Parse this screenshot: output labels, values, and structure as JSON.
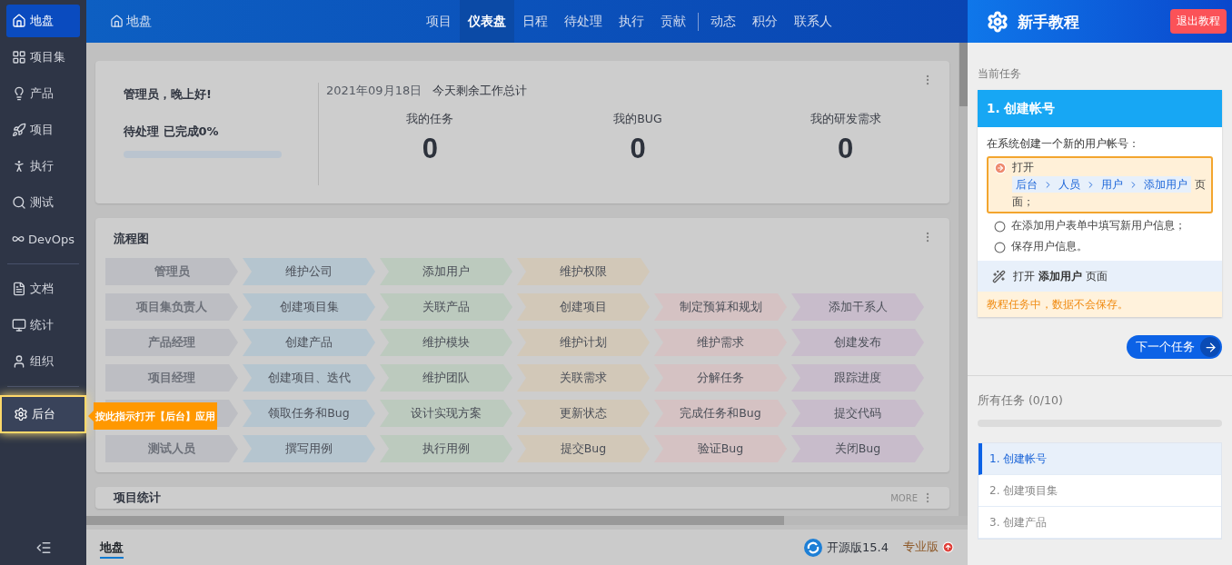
{
  "sidebar": {
    "groups": [
      [
        {
          "label": "地盘",
          "selected": true,
          "highlighted": false
        },
        {
          "label": "项目集",
          "selected": false,
          "highlighted": false
        },
        {
          "label": "产品",
          "selected": false,
          "highlighted": false
        },
        {
          "label": "项目",
          "selected": false,
          "highlighted": false
        },
        {
          "label": "执行",
          "selected": false,
          "highlighted": false
        },
        {
          "label": "测试",
          "selected": false,
          "highlighted": false
        },
        {
          "label": "DevOps",
          "selected": false,
          "highlighted": false
        }
      ],
      [
        {
          "label": "文档",
          "selected": false,
          "highlighted": false
        },
        {
          "label": "统计",
          "selected": false,
          "highlighted": false
        },
        {
          "label": "组织",
          "selected": false,
          "highlighted": false
        }
      ],
      [
        {
          "label": "后台",
          "selected": false,
          "highlighted": true
        }
      ]
    ],
    "tooltip": "按此指示打开【后台】应用"
  },
  "header": {
    "breadcrumb": "地盘",
    "nav_groups": [
      [
        {
          "label": "项目",
          "selected": false
        },
        {
          "label": "仪表盘",
          "selected": true
        },
        {
          "label": "日程",
          "selected": false
        },
        {
          "label": "待处理",
          "selected": false
        },
        {
          "label": "执行",
          "selected": false
        },
        {
          "label": "贡献",
          "selected": false
        }
      ],
      [
        {
          "label": "动态",
          "selected": false
        },
        {
          "label": "积分",
          "selected": false
        },
        {
          "label": "联系人",
          "selected": false
        }
      ]
    ]
  },
  "welcome": {
    "greeting": "管理员，晚上好!",
    "progress_label": "待处理 已完成0%",
    "level": 0,
    "date": "2021年09月18日",
    "summary_title": "今天剩余工作总计",
    "stats": [
      {
        "label": "我的任务",
        "value": "0"
      },
      {
        "label": "我的BUG",
        "value": "0"
      },
      {
        "label": "我的研发需求",
        "value": "0"
      }
    ]
  },
  "flowchart": {
    "title": "流程图",
    "rows": [
      {
        "role": "管理员",
        "steps": [
          "维护公司",
          "添加用户",
          "维护权限"
        ]
      },
      {
        "role": "项目集负责人",
        "steps": [
          "创建项目集",
          "关联产品",
          "创建项目",
          "制定预算和规划",
          "添加干系人"
        ]
      },
      {
        "role": "产品经理",
        "steps": [
          "创建产品",
          "维护模块",
          "维护计划",
          "维护需求",
          "创建发布"
        ]
      },
      {
        "role": "项目经理",
        "steps": [
          "创建项目、迭代",
          "维护团队",
          "关联需求",
          "分解任务",
          "跟踪进度"
        ]
      },
      {
        "steps": [
          "领取任务和Bug",
          "设计实现方案",
          "更新状态",
          "完成任务和Bug",
          "提交代码"
        ]
      },
      {
        "role": "测试人员",
        "steps": [
          "撰写用例",
          "执行用例",
          "提交Bug",
          "验证Bug",
          "关闭Bug"
        ]
      }
    ]
  },
  "project_stats": {
    "title": "项目统计",
    "more": "MORE"
  },
  "footer": {
    "tab": "地盘",
    "version": "开源版15.4",
    "upgrade": "专业版"
  },
  "tutorial": {
    "title": "新手教程",
    "exit": "退出教程",
    "current_label": "当前任务",
    "task_title": "1. 创建帐号",
    "description": "在系统创建一个新的用户帐号：",
    "steps": [
      {
        "kind": "current",
        "text": "打开",
        "path": [
          "后台",
          "人员",
          "用户",
          "添加用户"
        ],
        "suffix": "页面；"
      },
      {
        "kind": "todo",
        "text": "在添加用户表单中填写新用户信息；"
      },
      {
        "kind": "todo",
        "text": "保存用户信息。"
      }
    ],
    "hint": "打开 **添加用户** 页面",
    "warning": "教程任务中，数据不会保存。",
    "next": "下一个任务",
    "all_label": "所有任务 (0/10)",
    "level": 0,
    "tasks": [
      {
        "label": "1. 创建帐号",
        "selected": true
      },
      {
        "label": "2. 创建项目集",
        "selected": false
      },
      {
        "label": "3. 创建产品",
        "selected": false
      }
    ]
  }
}
